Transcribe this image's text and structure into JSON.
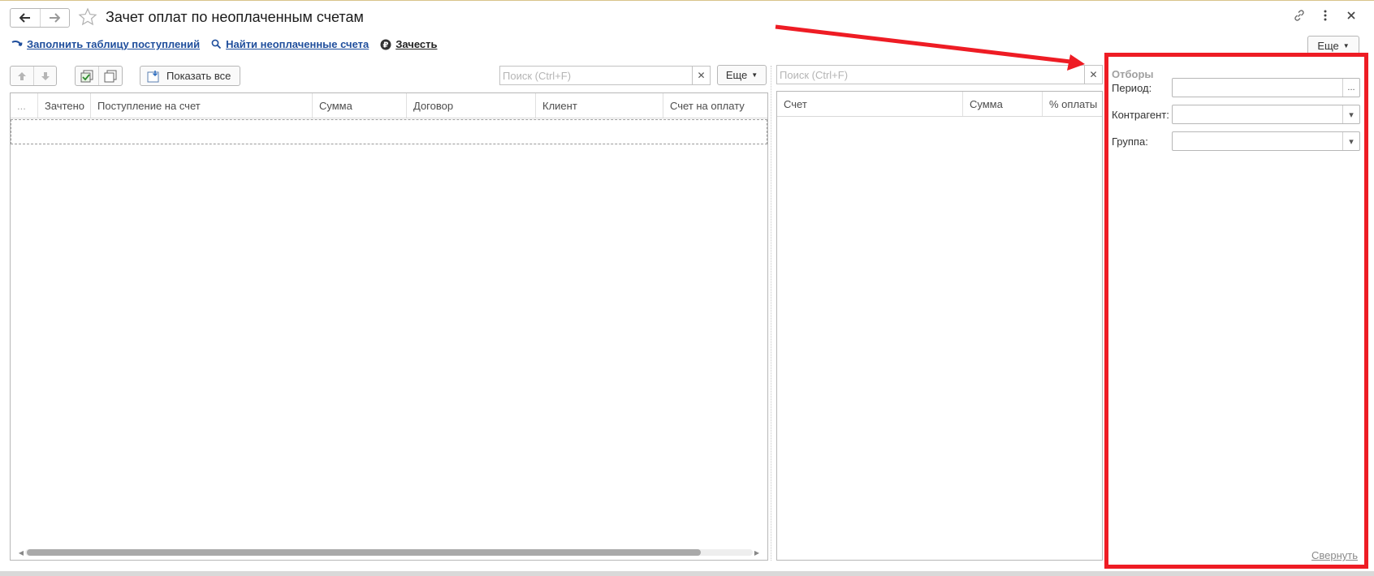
{
  "window": {
    "title": "Зачет оплат по неоплаченным счетам",
    "more_label": "Еще"
  },
  "commands": [
    {
      "label": "Заполнить таблицу поступлений",
      "icon": "fill-arrow-icon"
    },
    {
      "label": "Найти неоплаченные счета",
      "icon": "search-icon"
    },
    {
      "label": "Зачесть",
      "icon": "ruble-icon"
    }
  ],
  "left_panel": {
    "show_all_label": "Показать все",
    "search_placeholder": "Поиск (Ctrl+F)",
    "more_label": "Еще",
    "columns": [
      "...",
      "Зачтено",
      "Поступление на счет",
      "Сумма",
      "Договор",
      "Клиент",
      "Счет на оплату"
    ],
    "rows": []
  },
  "right_panel": {
    "search_placeholder": "Поиск (Ctrl+F)",
    "columns": [
      "Счет",
      "Сумма",
      "% оплаты"
    ],
    "rows": []
  },
  "filters": {
    "title": "Отборы",
    "fields": [
      {
        "label": "Период:",
        "value": "",
        "button": "..."
      },
      {
        "label": "Контрагент:",
        "value": "",
        "button": "▾"
      },
      {
        "label": "Группа:",
        "value": "",
        "button": "▾"
      }
    ],
    "collapse_label": "Свернуть"
  },
  "colors": {
    "highlight": "#ee1c24",
    "link": "#1f4e9c"
  }
}
